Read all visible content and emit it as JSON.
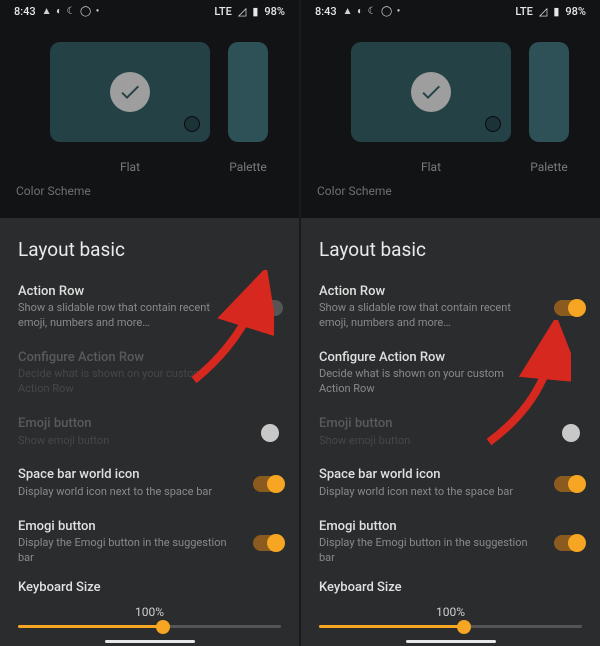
{
  "status": {
    "time": "8:43",
    "icons_left": "▲ ◐ ☾ ◯ •",
    "network": "LTE",
    "signal": "◿",
    "battery_pct": "98%"
  },
  "themes": {
    "flat_label": "Flat",
    "palette_label": "Palette"
  },
  "section_color_scheme": "Color Scheme",
  "group_title": "Layout basic",
  "items": {
    "action_row": {
      "title": "Action Row",
      "sub": "Show a slidable row that contain recent emoji, numbers and more…"
    },
    "configure": {
      "title": "Configure Action Row",
      "sub": "Decide what is shown on your custom Action Row"
    },
    "emoji_btn": {
      "title": "Emoji button",
      "sub": "Show emoji button"
    },
    "space_bar": {
      "title": "Space bar world icon",
      "sub": "Display world icon next to the space bar"
    },
    "emogi": {
      "title": "Emogi button",
      "sub": "Display the Emogi button in the suggestion bar"
    },
    "kbd_size": {
      "title": "Keyboard Size",
      "value": "100%"
    }
  },
  "left_state": {
    "action_row_on": false,
    "configure_enabled": false,
    "emoji_enabled": false
  },
  "right_state": {
    "action_row_on": true,
    "configure_enabled": true,
    "emoji_enabled": false
  },
  "slider_pct": 55,
  "colors": {
    "accent": "#f6a623",
    "arrow": "#d6281f"
  }
}
